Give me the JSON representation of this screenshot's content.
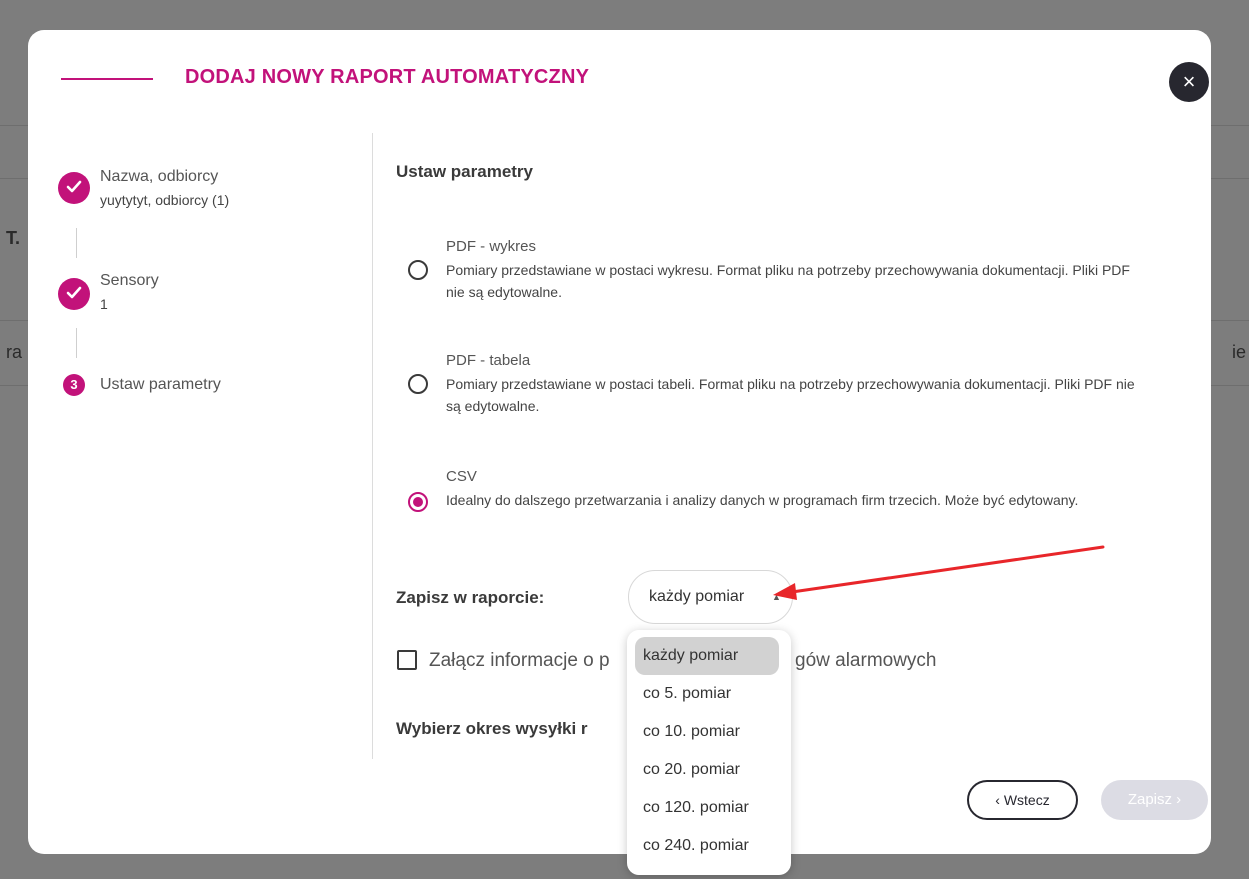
{
  "background": {
    "fragments": [
      "T.",
      "ra",
      "ie"
    ]
  },
  "modal": {
    "title": "DODAJ NOWY RAPORT AUTOMATYCZNY",
    "close_icon": "×"
  },
  "stepper": {
    "steps": [
      {
        "title": "Nazwa, odbiorcy",
        "subtitle": "yuytytyt, odbiorcy (1)",
        "state": "done"
      },
      {
        "title": "Sensory",
        "subtitle": "1",
        "state": "done"
      },
      {
        "title": "Ustaw parametry",
        "number": "3",
        "state": "active"
      }
    ]
  },
  "params": {
    "section_title": "Ustaw parametry",
    "options": [
      {
        "title": "PDF - wykres",
        "description": "Pomiary przedstawiane w postaci wykresu. Format pliku na potrzeby przechowywania dokumentacji. Pliki PDF nie są edytowalne.",
        "checked": false
      },
      {
        "title": "PDF - tabela",
        "description": "Pomiary przedstawiane w postaci tabeli. Format pliku na potrzeby przechowywania dokumentacji. Pliki PDF nie są edytowalne.",
        "checked": false
      },
      {
        "title": "CSV",
        "description": "Idealny do dalszego przetwarzania i analizy danych w programach firm trzecich. Może być edytowany.",
        "checked": true
      }
    ],
    "save_in_report_label": "Zapisz w raporcie:",
    "select_value": "każdy pomiar",
    "select_arrow": "▲",
    "checkbox_label_left": "Załącz informacje o p",
    "checkbox_label_right": "gów alarmowych",
    "period_label": "Wybierz okres wysyłki r"
  },
  "dropdown": {
    "items": [
      "każdy pomiar",
      "co 5. pomiar",
      "co 10. pomiar",
      "co 20. pomiar",
      "co 120. pomiar",
      "co 240. pomiar"
    ],
    "selected_index": 0
  },
  "footer": {
    "back_label": "‹ Wstecz",
    "save_label": "Zapisz ›"
  },
  "colors": {
    "accent": "#c2127a",
    "dark": "#27272f",
    "annotation_arrow": "#e8262a"
  }
}
